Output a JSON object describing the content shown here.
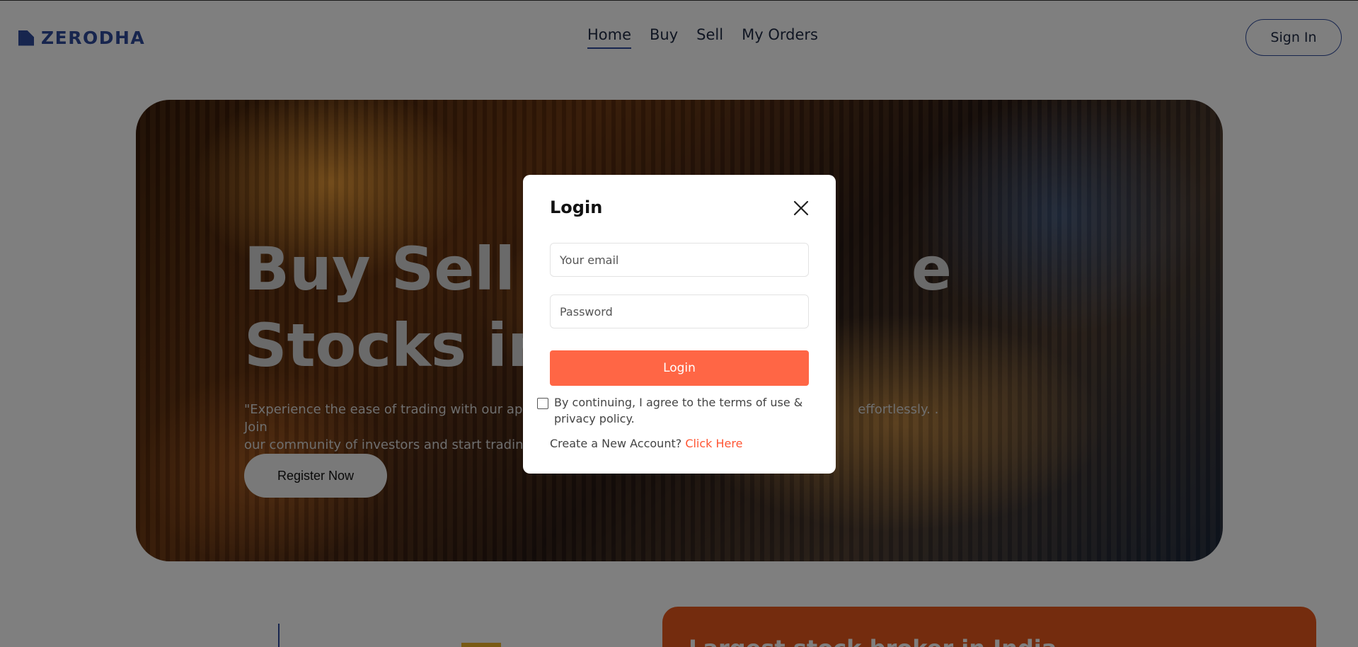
{
  "header": {
    "logo_text": "ZERODHA",
    "nav": [
      {
        "label": "Home",
        "active": true
      },
      {
        "label": "Buy",
        "active": false
      },
      {
        "label": "Sell",
        "active": false
      },
      {
        "label": "My Orders",
        "active": false
      }
    ],
    "signin_label": "Sign In"
  },
  "hero": {
    "title_line1": "Buy Sell Yo",
    "title_line1_tail": "e",
    "title_line2": "Stocks in S",
    "desc_left_1": "\"Experience the ease of trading with our app, a",
    "desc_right_1": "effortlessly. . Join",
    "desc_left_2": "our community of investors and start trading w",
    "register_label": "Register Now"
  },
  "section": {
    "card_title": "Largest stock broker in India"
  },
  "modal": {
    "title": "Login",
    "email_placeholder": "Your email",
    "password_placeholder": "Password",
    "login_label": "Login",
    "agree_text": "By continuing, I agree to the terms of use & privacy policy.",
    "create_text": "Create a New Account?",
    "create_link": "Click Here"
  },
  "colors": {
    "brand": "#2e4a9c",
    "accent": "#ff6645",
    "link": "#ff5533",
    "card": "#e8581c"
  }
}
